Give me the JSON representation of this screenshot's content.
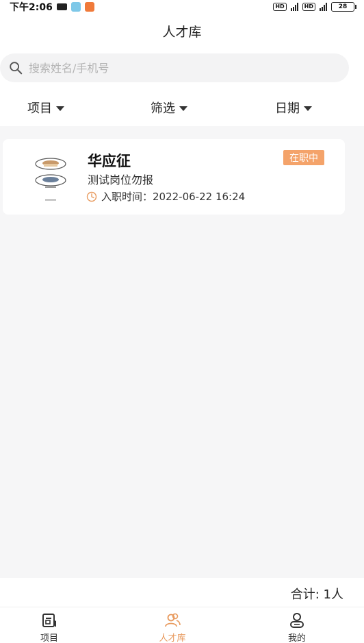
{
  "status_bar": {
    "time": "下午2:06",
    "battery": "28"
  },
  "header": {
    "title": "人才库"
  },
  "search": {
    "placeholder": "搜索姓名/手机号"
  },
  "filters": [
    {
      "label": "项目"
    },
    {
      "label": "筛选"
    },
    {
      "label": "日期"
    }
  ],
  "list": [
    {
      "name": "华应征",
      "status": "在职中",
      "position": "测试岗位勿报",
      "join_time": "入职时间：2022-06-22 16:24"
    }
  ],
  "footer": {
    "total": "合计: 1人"
  },
  "tabs": [
    {
      "label": "项目",
      "icon": "project-icon",
      "active": false
    },
    {
      "label": "人才库",
      "icon": "talent-icon",
      "active": true
    },
    {
      "label": "我的",
      "icon": "profile-icon",
      "active": false
    }
  ],
  "colors": {
    "accent": "#e89a5e",
    "badge": "#f4a36a",
    "background": "#f6f6f7"
  }
}
